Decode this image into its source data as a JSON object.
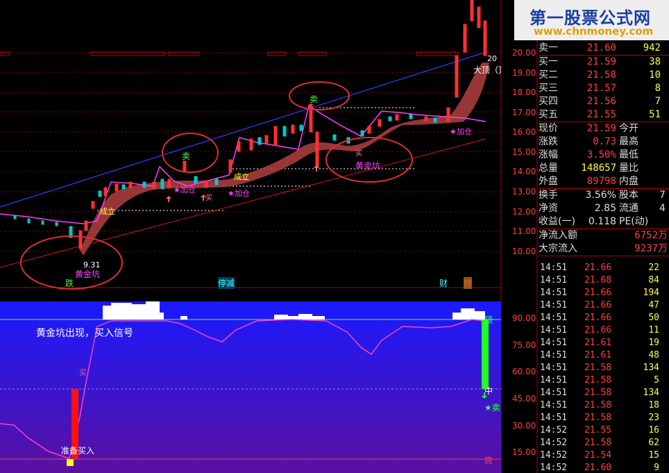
{
  "watermark": {
    "title": "第一股票公式网",
    "url": "www.chnmoney.com"
  },
  "main_chart": {
    "price_axis": [
      "20.00",
      "19.00",
      "18.00",
      "17.00",
      "16.00",
      "15.00",
      "14.00",
      "13.00",
      "12.00",
      "11.00",
      "10.00"
    ],
    "labels": {
      "sell1": "卖",
      "sell2": "卖",
      "add1": "★加仓",
      "add2": "★加仓",
      "add3": "★加仓",
      "form1": "成立",
      "form2": "成立",
      "buy1": "买",
      "buy2": "买",
      "buy3": "买",
      "gold_pit": "黄金坑",
      "gold_sell_pit": "黄卖坑",
      "low_price": "9.31",
      "big_top_value": "20",
      "big_top_text": "大顶（顶"
    },
    "bottom_tags": {
      "die": "跌",
      "tingjian": "停减",
      "cai": "财",
      "bang": "榜"
    }
  },
  "indicator": {
    "axis": [
      "90.00",
      "75.00",
      "60.00",
      "45.00",
      "30.00",
      "15.00"
    ],
    "signal_text": "黄金坑出现，买入信号",
    "prepare_buy": "准备买入",
    "buy_mark": "买",
    "sell_mark": "★卖",
    "top_mark": "顶",
    "mid_mark": "中",
    "bottom_mark": "底"
  },
  "quote_panel": {
    "sell1": {
      "label": "卖一",
      "price": "21.60",
      "vol": "942"
    },
    "buys": [
      {
        "label": "买一",
        "price": "21.59",
        "vol": "38"
      },
      {
        "label": "买二",
        "price": "21.58",
        "vol": "10"
      },
      {
        "label": "买三",
        "price": "21.57",
        "vol": "8"
      },
      {
        "label": "买四",
        "price": "21.56",
        "vol": "7"
      },
      {
        "label": "买五",
        "price": "21.55",
        "vol": "51"
      }
    ],
    "stats_left": [
      {
        "label": "现价",
        "value": "21.59"
      },
      {
        "label": "涨跌",
        "value": "0.73"
      },
      {
        "label": "涨幅",
        "value": "3.50%"
      },
      {
        "label": "总量",
        "value": "148657"
      },
      {
        "label": "外盘",
        "value": "89798"
      }
    ],
    "stats_right": [
      "今开",
      "最高",
      "最低",
      "量比",
      "内盘"
    ],
    "stats2": [
      {
        "label": "换手",
        "value": "3.56%",
        "right": "股本",
        "rv": "7"
      },
      {
        "label": "净资",
        "value": "2.85",
        "right": "流通",
        "rv": "4"
      },
      {
        "label": "收益(一)",
        "value": "0.118",
        "right": "PE(动)",
        "rv": ""
      }
    ],
    "flow": [
      {
        "label": "净流入额",
        "value": "6752万"
      },
      {
        "label": "大宗流入",
        "value": "9237万"
      }
    ],
    "trades": [
      {
        "time": "14:51",
        "price": "21.66",
        "vol": "22"
      },
      {
        "time": "14:51",
        "price": "21.68",
        "vol": "84"
      },
      {
        "time": "14:51",
        "price": "21.66",
        "vol": "194"
      },
      {
        "time": "14:51",
        "price": "21.66",
        "vol": "47"
      },
      {
        "time": "14:51",
        "price": "21.66",
        "vol": "50"
      },
      {
        "time": "14:51",
        "price": "21.66",
        "vol": "11"
      },
      {
        "time": "14:51",
        "price": "21.61",
        "vol": "19"
      },
      {
        "time": "14:51",
        "price": "21.61",
        "vol": "48"
      },
      {
        "time": "14:51",
        "price": "21.58",
        "vol": "134"
      },
      {
        "time": "14:51",
        "price": "21.58",
        "vol": "5"
      },
      {
        "time": "14:51",
        "price": "21.58",
        "vol": "134"
      },
      {
        "time": "14:51",
        "price": "21.58",
        "vol": "18"
      },
      {
        "time": "14:51",
        "price": "21.58",
        "vol": "23"
      },
      {
        "time": "14:52",
        "price": "21.55",
        "vol": "16"
      },
      {
        "time": "14:52",
        "price": "21.58",
        "vol": "62"
      },
      {
        "time": "14:52",
        "price": "21.54",
        "vol": "15"
      },
      {
        "time": "14:52",
        "price": "21.60",
        "vol": "9"
      }
    ]
  },
  "colors": {
    "up": "#ff3030",
    "down": "#00c8c8",
    "magenta": "#ff40ff",
    "yellow": "#ffff40"
  }
}
